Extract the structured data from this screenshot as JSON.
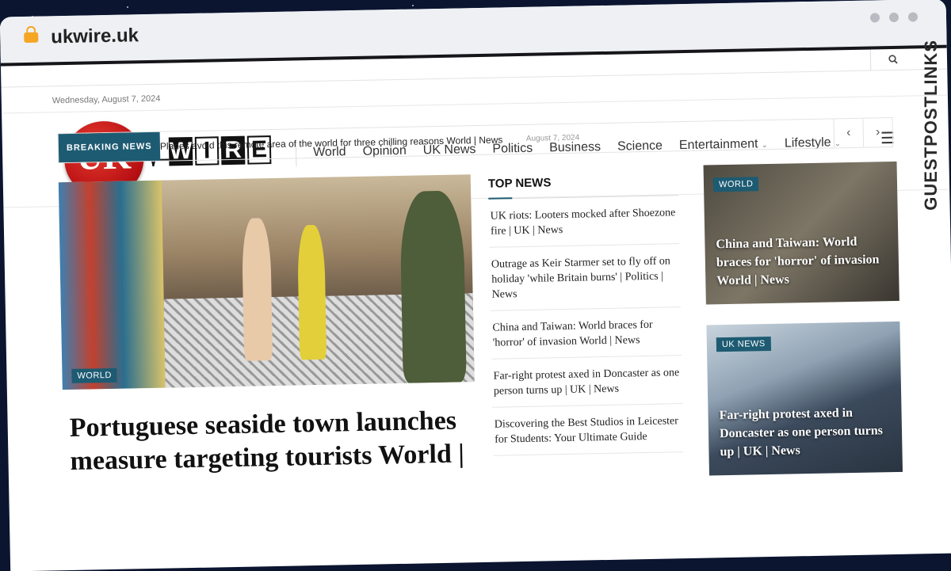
{
  "browser": {
    "url": "ukwire.uk"
  },
  "site": {
    "date": "Wednesday, August 7, 2024",
    "logo": {
      "left": "UK",
      "right_letters": [
        "W",
        "I",
        "R",
        "E"
      ]
    },
    "nav": [
      {
        "label": "World"
      },
      {
        "label": "Opinion"
      },
      {
        "label": "UK News"
      },
      {
        "label": "Politics"
      },
      {
        "label": "Business"
      },
      {
        "label": "Science"
      },
      {
        "label": "Entertainment",
        "dropdown": true
      },
      {
        "label": "Lifestyle",
        "dropdown": true
      }
    ]
  },
  "breaking": {
    "label": "BREAKING NEWS",
    "headline": "Planes avoid this remote area of the world for three chilling reasons World | News",
    "date": "August 7, 2024"
  },
  "hero": {
    "category": "WORLD",
    "title": "Portuguese seaside town launches measure targeting tourists World |"
  },
  "top_news": {
    "heading": "TOP NEWS",
    "items": [
      "UK riots: Looters mocked after Shoezone fire | UK | News",
      "Outrage as Keir Starmer set to fly off on holiday 'while Britain burns' | Politics | News",
      "China and Taiwan: World braces for 'horror' of invasion World | News",
      "Far-right protest axed in Doncaster as one person turns up | UK | News",
      "Discovering the Best Studios in Leicester for Students: Your Ultimate Guide"
    ]
  },
  "cards": [
    {
      "category": "WORLD",
      "title": "China and Taiwan: World braces for 'horror' of invasion World | News"
    },
    {
      "category": "UK NEWS",
      "title": "Far-right protest axed in Doncaster as one person turns up | UK | News"
    }
  ],
  "side_banner": {
    "text": "GUESTPOSTLINKS"
  },
  "colors": {
    "accent": "#1d5b72",
    "logo_red": "#d11f1f",
    "lock": "#f5a623"
  }
}
